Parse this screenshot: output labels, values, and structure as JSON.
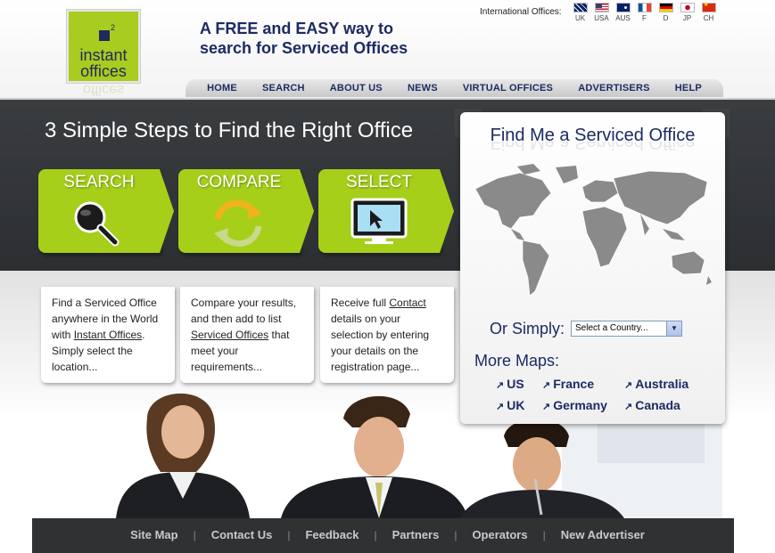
{
  "header": {
    "logo": {
      "line1": "instant",
      "line2": "offices",
      "superscript": "2"
    },
    "tagline_line1": "A FREE and EASY way to",
    "tagline_line2": "search for Serviced Offices",
    "international_label": "International Offices:",
    "flags": [
      {
        "code": "UK",
        "icon": "uk-flag-icon"
      },
      {
        "code": "USA",
        "icon": "usa-flag-icon"
      },
      {
        "code": "AUS",
        "icon": "australia-flag-icon"
      },
      {
        "code": "F",
        "icon": "france-flag-icon"
      },
      {
        "code": "D",
        "icon": "germany-flag-icon"
      },
      {
        "code": "JP",
        "icon": "japan-flag-icon"
      },
      {
        "code": "CH",
        "icon": "china-flag-icon"
      }
    ]
  },
  "nav": {
    "items": [
      "HOME",
      "SEARCH",
      "ABOUT US",
      "NEWS",
      "VIRTUAL OFFICES",
      "ADVERTISERS",
      "HELP"
    ]
  },
  "steps": {
    "title": "3 Simple Steps to Find the Right Office",
    "items": [
      {
        "label": "SEARCH",
        "icon": "magnifier-icon"
      },
      {
        "label": "COMPARE",
        "icon": "refresh-arrows-icon"
      },
      {
        "label": "SELECT",
        "icon": "monitor-cursor-icon"
      }
    ]
  },
  "cards": [
    {
      "pre": "Find a Serviced Office anywhere in the World with ",
      "link": "Instant Offices",
      "post": ". Simply select the location..."
    },
    {
      "pre": "Compare your results, and then add to list ",
      "link": "Serviced Offices",
      "post": " that meet your requirements..."
    },
    {
      "pre": "Receive full ",
      "link": "Contact",
      "post": " details on your selection by entering your details on the registration page..."
    }
  ],
  "map_panel": {
    "title": "Find Me a Serviced Office",
    "simply_label": "Or Simply:",
    "select_placeholder": "Select a Country...",
    "more_maps_label": "More Maps:",
    "links": [
      "US",
      "France",
      "Australia",
      "UK",
      "Germany",
      "Canada"
    ]
  },
  "footer": {
    "links": [
      "Site Map",
      "Contact Us",
      "Feedback",
      "Partners",
      "Operators",
      "New Advertiser"
    ]
  },
  "colors": {
    "brand_green": "#a6cf1a",
    "navy": "#1d2a63",
    "dark_band": "#3a3d40"
  }
}
